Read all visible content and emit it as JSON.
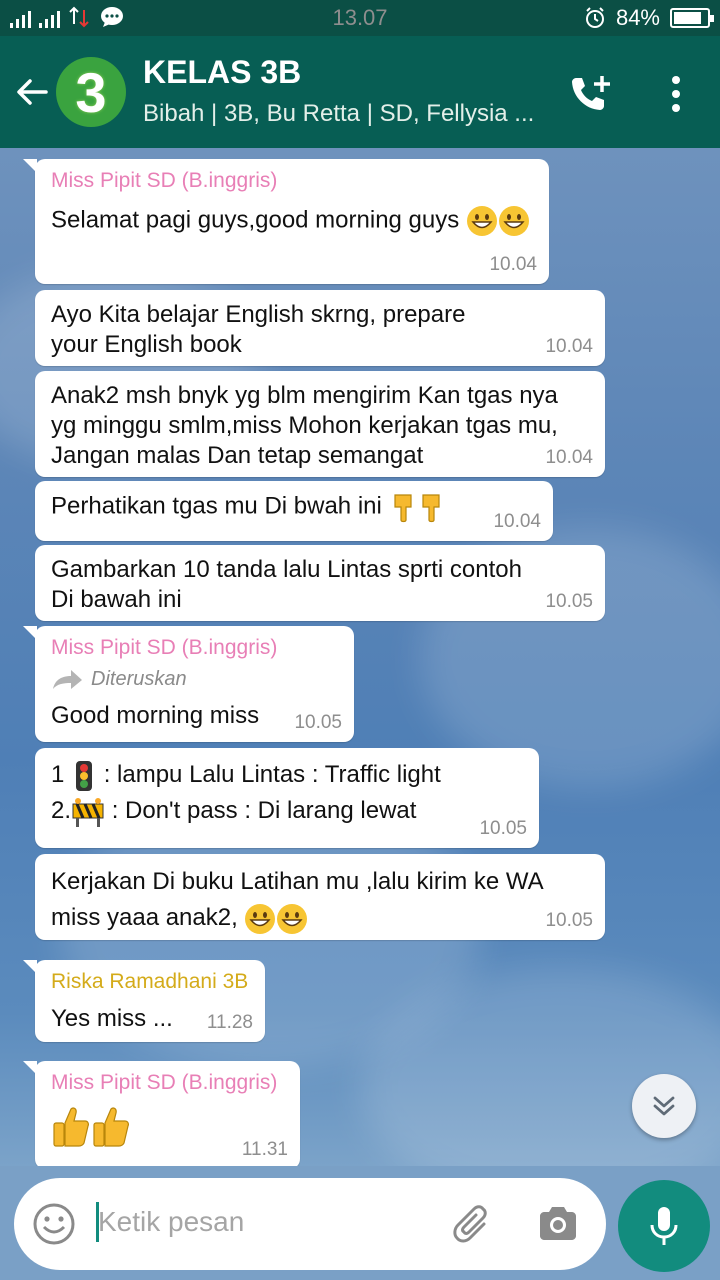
{
  "status_bar": {
    "time": "13.07",
    "battery": "84%",
    "battery_level": 0.84
  },
  "header": {
    "avatar_text": "3",
    "title": "KELAS 3B",
    "subtitle": "Bibah | 3B, Bu Retta | SD, Fellysia ..."
  },
  "messages": [
    {
      "sender": "Miss Pipit SD (B.inggris)",
      "text": "Selamat pagi guys,good morning guys",
      "time": "10.04"
    },
    {
      "text": "Ayo Kita belajar English skrng, prepare your English book",
      "time": "10.04"
    },
    {
      "text": "Anak2 msh bnyk yg blm mengirim Kan tgas nya yg minggu smlm,miss Mohon kerjakan tgas mu, Jangan malas Dan tetap semangat",
      "time": "10.04"
    },
    {
      "text": "Perhatikan tgas mu Di bwah ini",
      "time": "10.04"
    },
    {
      "text": "Gambarkan 10 tanda lalu Lintas sprti contoh Di bawah ini",
      "time": "10.05"
    },
    {
      "sender": "Miss Pipit SD (B.inggris)",
      "forwarded": "Diteruskan",
      "text": "Good morning miss",
      "time": "10.05"
    },
    {
      "line1_a": "1",
      "line1_b": ": lampu Lalu Lintas : Traffic light",
      "line2_a": "2.",
      "line2_b": ": Don't pass : Di larang lewat",
      "time": "10.05"
    },
    {
      "text": "Kerjakan Di buku Latihan mu ,lalu kirim ke WA miss yaaa anak2,",
      "time": "10.05"
    },
    {
      "sender": "Riska Ramadhani 3B",
      "text": "Yes miss ...",
      "time": "11.28"
    },
    {
      "sender": "Miss Pipit SD (B.inggris)",
      "time": "11.31"
    }
  ],
  "input": {
    "placeholder": "Ketik pesan"
  },
  "colors": {
    "header": "#075e54",
    "status_bar": "#0b4f45",
    "accent": "#128c7e",
    "sender_pink": "#e87fb6",
    "sender_gold": "#d4ab1a"
  },
  "icons": {
    "header": [
      "arrow-back-icon",
      "add-call-icon",
      "more-vert-icon"
    ],
    "status": [
      "signal-icon",
      "message-icon",
      "alarm-icon",
      "battery-icon"
    ],
    "input": [
      "emoji-icon",
      "attach-icon",
      "camera-icon",
      "mic-icon"
    ],
    "chat": [
      "forward-arrow-icon",
      "grinning-face-emoji",
      "pointing-down-emoji",
      "traffic-light-emoji",
      "construction-barrier-emoji",
      "thumbs-up-emoji",
      "double-chevron-down-icon"
    ]
  }
}
